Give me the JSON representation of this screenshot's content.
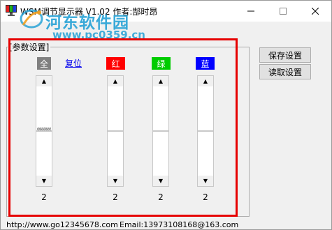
{
  "window": {
    "title": "WSM调节显示器  V1.02    作者:郜时昂"
  },
  "watermark": {
    "site_name": "河东软件园",
    "site_url": "www.pc0359.cn"
  },
  "group": {
    "legend": "[参数设置]"
  },
  "channels": [
    {
      "id": "all",
      "label": "全",
      "color": "#808080",
      "value": "2",
      "level": 0.48
    },
    {
      "id": "red",
      "label": "红",
      "color": "#ff0000",
      "value": "2",
      "level": 0.5
    },
    {
      "id": "green",
      "label": "绿",
      "color": "#00cc00",
      "value": "2",
      "level": 0.5
    },
    {
      "id": "blue",
      "label": "蓝",
      "color": "#0000ff",
      "value": "2",
      "level": 0.5
    }
  ],
  "reset_label": "复位",
  "buttons": {
    "save": "保存设置",
    "load": "读取设置"
  },
  "status": {
    "url": "http://www.go12345678.com",
    "email": "Email:13973108168@163.com"
  },
  "icons": {
    "app": "monitor-app-icon",
    "minimize": "minimize-icon",
    "maximize": "maximize-icon",
    "close": "close-icon",
    "up": "arrow-up-icon",
    "down": "arrow-down-icon"
  },
  "colors": {
    "highlight_frame": "#e60000",
    "watermark": "#2aa3d6",
    "link": "#0000ee"
  }
}
